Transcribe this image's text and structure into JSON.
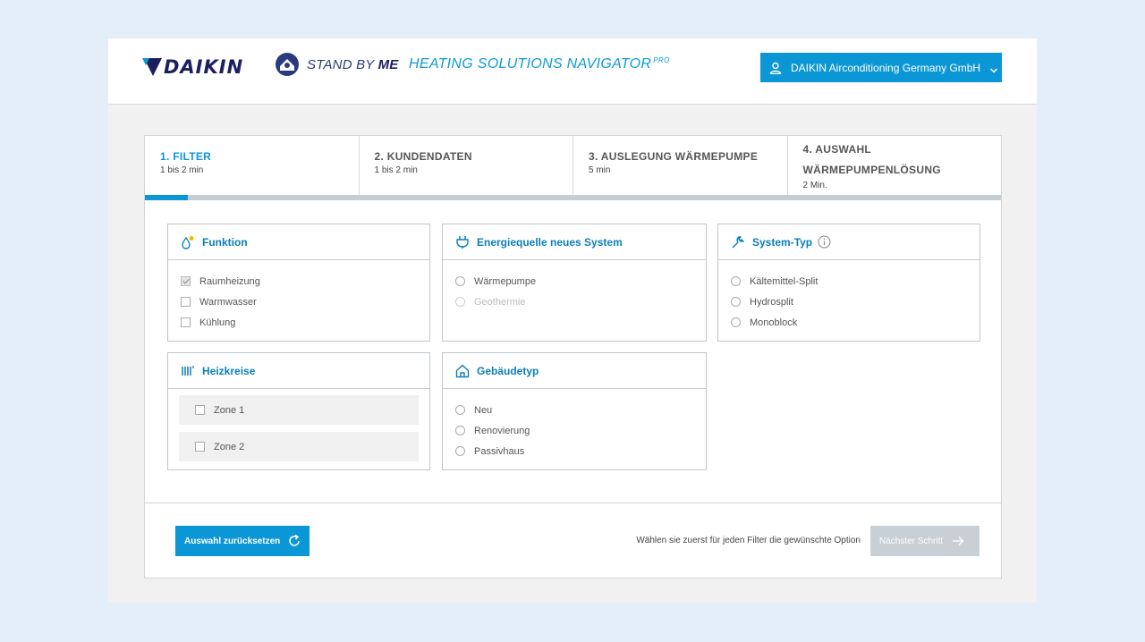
{
  "header": {
    "brand": "DAIKIN",
    "standby_pre": "STAND BY ",
    "standby_bold": "ME",
    "nav_title": "HEATING SOLUTIONS NAVIGATOR",
    "nav_sup": "PRO",
    "account_label": "DAIKIN Airconditioning Germany GmbH",
    "brand_color": "#0b97d6"
  },
  "steps": [
    {
      "title": "1. FILTER",
      "time": "1 bis 2 min",
      "active": true
    },
    {
      "title": "2. KUNDENDATEN",
      "time": "1 bis 2 min",
      "active": false
    },
    {
      "title": "3. AUSLEGUNG WÄRMEPUMPE",
      "time": "5 min",
      "active": false
    },
    {
      "title_line1": "4. AUSWAHL",
      "title_line2": "WÄRMEPUMPENLÖSUNG",
      "time": "2 Min.",
      "active": false
    }
  ],
  "progress": {
    "fraction": 0.05
  },
  "panels": {
    "funktion": {
      "title": "Funktion",
      "icon": "droplet-sun-icon",
      "options": [
        {
          "label": "Raumheizung",
          "checked": true
        },
        {
          "label": "Warmwasser",
          "checked": false
        },
        {
          "label": "Kühlung",
          "checked": false
        }
      ]
    },
    "energie": {
      "title": "Energiequelle neues System",
      "icon": "plug-icon",
      "options": [
        {
          "label": "Wärmepumpe",
          "disabled": false
        },
        {
          "label": "Geothermie",
          "disabled": true
        }
      ]
    },
    "systemtyp": {
      "title": "System-Typ",
      "icon": "wrench-icon",
      "options": [
        {
          "label": "Kältemittel-Split"
        },
        {
          "label": "Hydrosplit"
        },
        {
          "label": "Monoblock"
        }
      ]
    },
    "heizkreise": {
      "title": "Heizkreise",
      "icon": "radiator-icon",
      "zones": [
        {
          "label": "Zone 1",
          "checked": false
        },
        {
          "label": "Zone 2",
          "checked": false
        }
      ]
    },
    "gebaeude": {
      "title": "Gebäudetyp",
      "icon": "house-icon",
      "options": [
        {
          "label": "Neu"
        },
        {
          "label": "Renovierung"
        },
        {
          "label": "Passivhaus"
        }
      ]
    }
  },
  "footer": {
    "reset_label": "Auswahl zurücksetzen",
    "hint": "Wählen sie zuerst für jeden Filter die gewünschte Option",
    "next_label": "Nächster Schritt"
  }
}
